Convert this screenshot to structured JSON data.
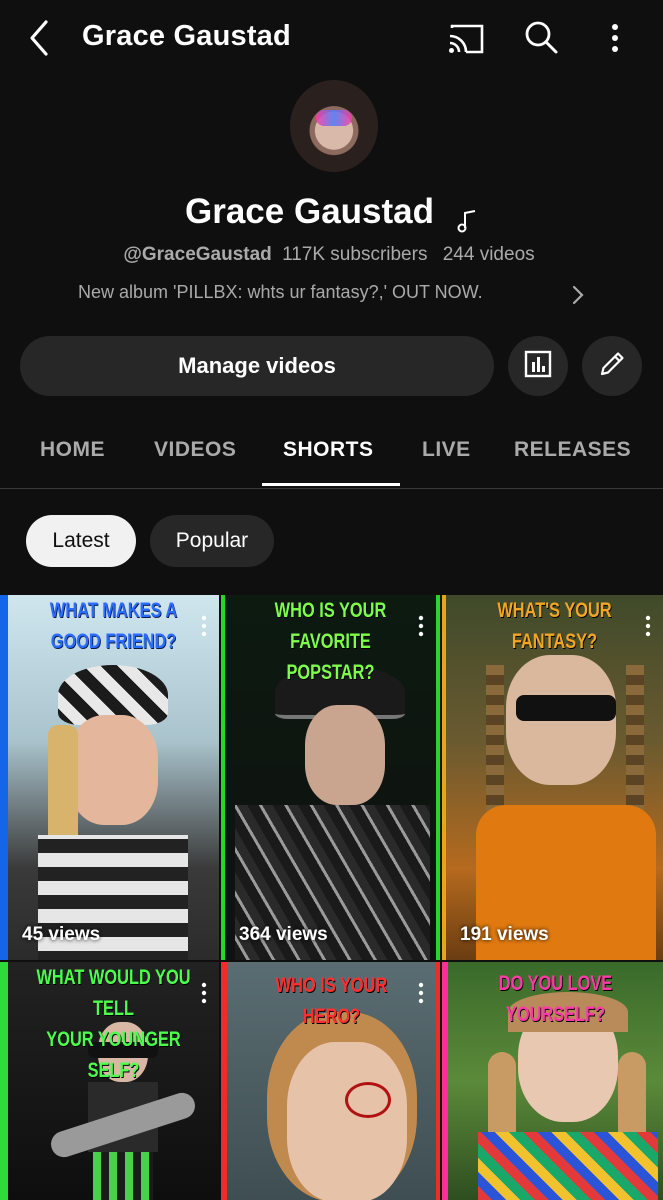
{
  "top_bar": {
    "title": "Grace Gaustad",
    "icons": [
      "back-arrow-icon",
      "cast-icon",
      "search-icon",
      "more-vertical-icon"
    ]
  },
  "channel": {
    "name": "Grace Gaustad",
    "name_icon": "music-note-icon",
    "handle": "@GraceGaustad",
    "subscribers": "117K subscribers",
    "videos": "244 videos",
    "description": "New album 'PILLBX: whts ur fantasy?,' OUT NOW.",
    "avatar": "channel-avatar"
  },
  "actions": {
    "manage_label": "Manage videos",
    "analytics_icon": "analytics-icon",
    "edit_icon": "pencil-icon"
  },
  "tabs": [
    {
      "label": "HOME",
      "active": false
    },
    {
      "label": "VIDEOS",
      "active": false
    },
    {
      "label": "SHORTS",
      "active": true
    },
    {
      "label": "LIVE",
      "active": false
    },
    {
      "label": "RELEASES",
      "active": false
    }
  ],
  "filters": {
    "latest": "Latest",
    "popular": "Popular",
    "selected": "Latest"
  },
  "shorts": [
    {
      "caption_1": "WHAT MAKES A",
      "caption_2": "GOOD FRIEND?",
      "views": "45 views",
      "border": "#1565e8",
      "caption_color": "#2a6cff"
    },
    {
      "caption_1": "WHO IS YOUR FAVORITE",
      "caption_2": "POPSTAR?",
      "views": "364 views",
      "border": "#28d62a",
      "caption_color": "#7dff4a"
    },
    {
      "caption_1": "WHAT'S YOUR FANTASY?",
      "caption_2": "",
      "views": "191 views",
      "border": "#e8a51a",
      "caption_color": "#f2a623"
    },
    {
      "caption_1": "WHAT WOULD YOU TELL",
      "caption_2": "YOUR YOUNGER SELF?",
      "views": "",
      "border": "#2edb3a",
      "caption_color": "#4dff4d"
    },
    {
      "caption_1": "WHO IS YOUR HERO?",
      "caption_2": "",
      "views": "",
      "border": "#ef2b2b",
      "caption_color": "#ff2f2f"
    },
    {
      "caption_1": "DO YOU LOVE YOURSELF?",
      "caption_2": "",
      "views": "",
      "border": "#ff2e9a",
      "caption_color": "#ff3aa8"
    }
  ]
}
